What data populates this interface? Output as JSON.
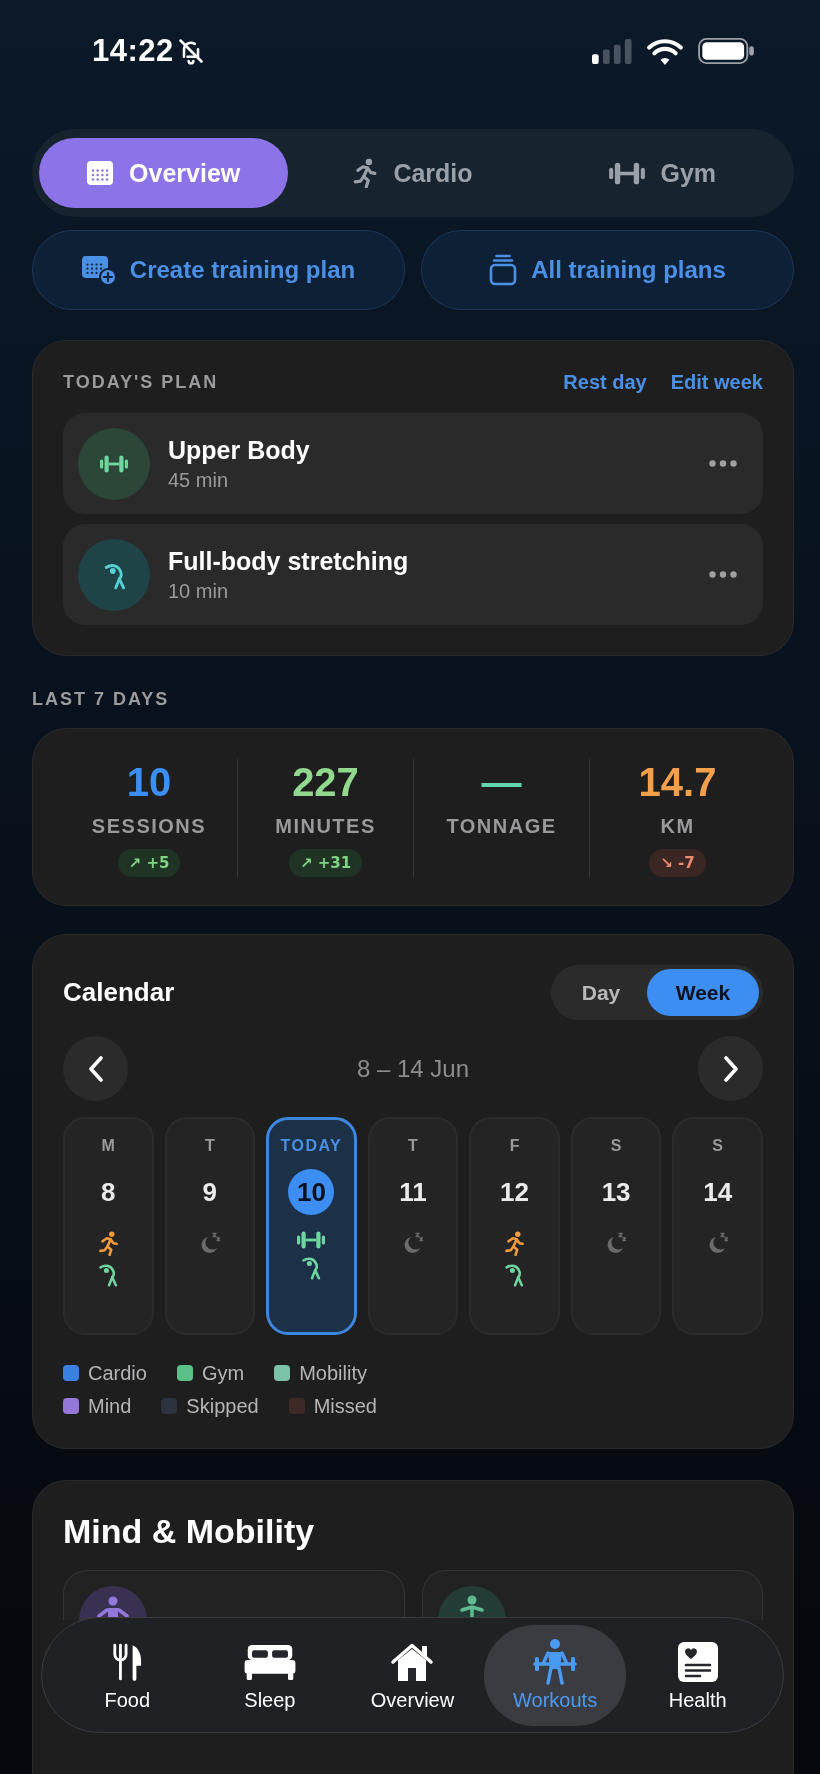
{
  "status_bar": {
    "time": "14:22"
  },
  "segments": [
    {
      "kind": "overview",
      "label": "Overview",
      "selected": true
    },
    {
      "kind": "cardio",
      "label": "Cardio",
      "selected": false
    },
    {
      "kind": "gym",
      "label": "Gym",
      "selected": false
    }
  ],
  "actions": [
    {
      "kind": "create",
      "label": "Create training plan"
    },
    {
      "kind": "browse",
      "label": "All training plans"
    }
  ],
  "todays_plan": {
    "title": "TODAY'S PLAN",
    "links": [
      "Rest day",
      "Edit week"
    ],
    "items": [
      {
        "kind": "gym",
        "title": "Upper Body",
        "duration": "45 min"
      },
      {
        "kind": "mobility",
        "title": "Full-body stretching",
        "duration": "10 min"
      }
    ]
  },
  "last_7_days": {
    "title": "LAST 7 DAYS",
    "stats": [
      {
        "value": "10",
        "label": "SESSIONS",
        "color": "#3b8ef3",
        "change": {
          "text": "↗ +5",
          "positive": true
        }
      },
      {
        "value": "227",
        "label": "MINUTES",
        "color": "#90d88e",
        "change": {
          "text": "↗ +31",
          "positive": true
        }
      },
      {
        "value": "—",
        "label": "TONNAGE",
        "color": "#62d6ad"
      },
      {
        "value": "14.7",
        "label": "KM",
        "color": "#f3a04c",
        "change": {
          "text": "↘ -7",
          "positive": false
        }
      }
    ]
  },
  "calendar": {
    "title": "Calendar",
    "views": [
      {
        "label": "Day",
        "selected": false
      },
      {
        "label": "Week",
        "selected": true
      }
    ],
    "range": "8 – 14 Jun",
    "days": [
      {
        "weekday": "M",
        "date": "8",
        "today": false,
        "activities": [
          {
            "kind": "cardio"
          },
          {
            "kind": "mobility"
          }
        ]
      },
      {
        "weekday": "T",
        "date": "9",
        "today": false,
        "activities": [
          {
            "kind": "rest"
          }
        ]
      },
      {
        "weekday": "TODAY",
        "date": "10",
        "today": true,
        "activities": [
          {
            "kind": "gym"
          },
          {
            "kind": "mobility"
          }
        ]
      },
      {
        "weekday": "T",
        "date": "11",
        "today": false,
        "activities": [
          {
            "kind": "rest"
          }
        ]
      },
      {
        "weekday": "F",
        "date": "12",
        "today": false,
        "activities": [
          {
            "kind": "cardio"
          },
          {
            "kind": "mobility"
          }
        ]
      },
      {
        "weekday": "S",
        "date": "13",
        "today": false,
        "activities": [
          {
            "kind": "rest"
          }
        ]
      },
      {
        "weekday": "S",
        "date": "14",
        "today": false,
        "activities": [
          {
            "kind": "rest"
          }
        ]
      }
    ],
    "legend": [
      {
        "label": "Cardio",
        "color": "#3a80e0"
      },
      {
        "label": "Gym",
        "color": "#5bbf88"
      },
      {
        "label": "Mobility",
        "color": "#7cc2a8"
      },
      {
        "label": "Mind",
        "color": "#9378d8"
      },
      {
        "label": "Skipped",
        "color": "#2c3240"
      },
      {
        "label": "Missed",
        "color": "#3d2a27"
      }
    ]
  },
  "mind_mobility": {
    "title": "Mind & Mobility",
    "cards": [
      {
        "kind": "mind"
      },
      {
        "kind": "mobility"
      }
    ]
  },
  "tab_bar": [
    {
      "kind": "food",
      "label": "Food",
      "selected": false
    },
    {
      "kind": "sleep",
      "label": "Sleep",
      "selected": false
    },
    {
      "kind": "overview",
      "label": "Overview",
      "selected": false
    },
    {
      "kind": "workouts",
      "label": "Workouts",
      "selected": true
    },
    {
      "kind": "health",
      "label": "Health",
      "selected": false
    }
  ]
}
